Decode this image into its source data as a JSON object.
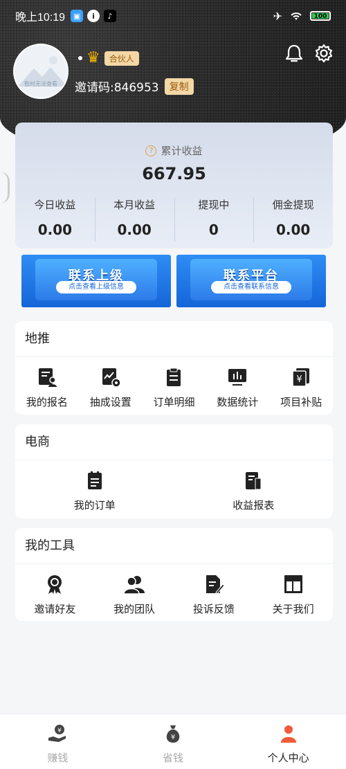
{
  "status_bar": {
    "time": "晚上10:19",
    "battery": "100"
  },
  "profile": {
    "avatar_text": "暂时无法查看",
    "role_badge": "合伙人",
    "invite_code": "邀请码:846953",
    "copy_label": "复制"
  },
  "earnings": {
    "title": "累计收益",
    "total": "667.95",
    "stats": [
      {
        "label": "今日收益",
        "value": "0.00"
      },
      {
        "label": "本月收益",
        "value": "0.00"
      },
      {
        "label": "提现中",
        "value": "0"
      },
      {
        "label": "佣金提现",
        "value": "0.00"
      }
    ]
  },
  "banners": [
    {
      "title": "联系上级",
      "subtitle": "点击查看上级信息"
    },
    {
      "title": "联系平台",
      "subtitle": "点击查看联系信息"
    }
  ],
  "sections": {
    "ditui": {
      "title": "地推",
      "items": [
        {
          "label": "我的报名",
          "icon": "doc-person-icon"
        },
        {
          "label": "抽成设置",
          "icon": "chart-gear-icon"
        },
        {
          "label": "订单明细",
          "icon": "clipboard-icon"
        },
        {
          "label": "数据统计",
          "icon": "monitor-chart-icon"
        },
        {
          "label": "项目补贴",
          "icon": "yuan-doc-icon"
        }
      ]
    },
    "dianshang": {
      "title": "电商",
      "items": [
        {
          "label": "我的订单",
          "icon": "order-icon"
        },
        {
          "label": "收益报表",
          "icon": "report-icon"
        }
      ]
    },
    "tools": {
      "title": "我的工具",
      "items": [
        {
          "label": "邀请好友",
          "icon": "award-icon"
        },
        {
          "label": "我的团队",
          "icon": "team-icon"
        },
        {
          "label": "投诉反馈",
          "icon": "feedback-icon"
        },
        {
          "label": "关于我们",
          "icon": "layout-icon"
        }
      ]
    }
  },
  "bottom_nav": [
    {
      "label": "赚钱",
      "active": false
    },
    {
      "label": "省钱",
      "active": false
    },
    {
      "label": "个人中心",
      "active": true
    }
  ],
  "colors": {
    "accent": "#f15a3a",
    "badge_bg": "#f3d8a6",
    "banner_blue": "#1565d8"
  }
}
